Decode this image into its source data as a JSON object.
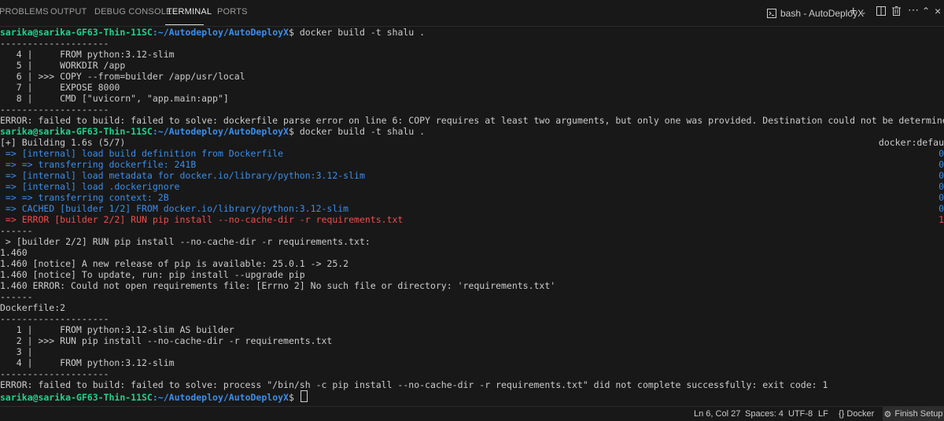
{
  "panel": {
    "tabs": [
      {
        "label": "PROBLEMS"
      },
      {
        "label": "OUTPUT"
      },
      {
        "label": "DEBUG CONSOLE"
      },
      {
        "label": "TERMINAL"
      },
      {
        "label": "PORTS"
      }
    ],
    "active_tab": "TERMINAL",
    "terminal_title": "bash - AutoDeployX",
    "icons": [
      "terminal-icon",
      "plus-icon",
      "chevron-down-icon",
      "split-icon",
      "trash-icon",
      "more-icon",
      "maximize-icon",
      "close-icon"
    ]
  },
  "terminal": {
    "prompt_user": "sarika@sarika-GF63-Thin-11SC",
    "prompt_path": ":~/Autodeploy/AutoDeployX",
    "command": "$ docker build -t shalu .",
    "lines": [
      {
        "text": "--------------------",
        "color": "default"
      },
      {
        "text": "   4 |     FROM python:3.12-slim",
        "color": "default"
      },
      {
        "text": "   5 |     WORKDIR /app",
        "color": "default"
      },
      {
        "text": "   6 | >>> COPY --from=builder /app/usr/local",
        "color": "default"
      },
      {
        "text": "   7 |     EXPOSE 8000",
        "color": "default"
      },
      {
        "text": "   8 |     CMD [\"uvicorn\", \"app.main:app\"]",
        "color": "default"
      },
      {
        "text": "--------------------",
        "color": "default"
      },
      {
        "text": "ERROR: failed to build: failed to solve: dockerfile parse error on line 6: COPY requires at least two arguments, but only one was provided. Destination could not be determined",
        "color": "default"
      },
      {
        "prompt": true
      },
      {
        "text": "[+] Building 1.6s (5/7)",
        "color": "default",
        "right": "docker:defau",
        "right_color": "default"
      },
      {
        "text": " => [internal] load build definition from Dockerfile",
        "color": "blue",
        "right": "0",
        "right_color": "blue"
      },
      {
        "text": " => => transferring dockerfile: 241B",
        "color": "blue",
        "right": "0",
        "right_color": "blue"
      },
      {
        "text": " => [internal] load metadata for docker.io/library/python:3.12-slim",
        "color": "blue",
        "right": "0",
        "right_color": "blue"
      },
      {
        "text": " => [internal] load .dockerignore",
        "color": "blue",
        "right": "0",
        "right_color": "blue"
      },
      {
        "text": " => => transferring context: 2B",
        "color": "blue",
        "right": "0",
        "right_color": "blue"
      },
      {
        "text": " => CACHED [builder 1/2] FROM docker.io/library/python:3.12-slim",
        "color": "blue",
        "right": "0",
        "right_color": "blue"
      },
      {
        "text": " => ERROR [builder 2/2] RUN pip install --no-cache-dir -r requirements.txt",
        "color": "red",
        "right": "1",
        "right_color": "red"
      },
      {
        "text": "------",
        "color": "default"
      },
      {
        "text": " > [builder 2/2] RUN pip install --no-cache-dir -r requirements.txt:",
        "color": "default"
      },
      {
        "text": "1.460",
        "color": "default"
      },
      {
        "text": "1.460 [notice] A new release of pip is available: 25.0.1 -> 25.2",
        "color": "default"
      },
      {
        "text": "1.460 [notice] To update, run: pip install --upgrade pip",
        "color": "default"
      },
      {
        "text": "1.460 ERROR: Could not open requirements file: [Errno 2] No such file or directory: 'requirements.txt'",
        "color": "default"
      },
      {
        "text": "------",
        "color": "default"
      },
      {
        "text": "Dockerfile:2",
        "color": "default"
      },
      {
        "text": "--------------------",
        "color": "default"
      },
      {
        "text": "   1 |     FROM python:3.12-slim AS builder",
        "color": "default"
      },
      {
        "text": "   2 | >>> RUN pip install --no-cache-dir -r requirements.txt",
        "color": "default"
      },
      {
        "text": "   3 |",
        "color": "default"
      },
      {
        "text": "   4 |     FROM python:3.12-slim",
        "color": "default"
      },
      {
        "text": "--------------------",
        "color": "default"
      },
      {
        "text": "ERROR: failed to build: failed to solve: process \"/bin/sh -c pip install --no-cache-dir -r requirements.txt\" did not complete successfully: exit code: 1",
        "color": "default"
      },
      {
        "prompt": true,
        "final": true
      }
    ]
  },
  "statusbar": {
    "position": "Ln 6, Col 27",
    "spaces": "Spaces: 4",
    "encoding": "UTF-8",
    "eol": "LF",
    "language": "{} Docker",
    "finish_setup": "Finish Setup"
  },
  "colors": {
    "background": "#181818",
    "text": "#cccccc",
    "blue": "#3b8eea",
    "red": "#f14c4c",
    "prompt_green": "#23d18b"
  }
}
